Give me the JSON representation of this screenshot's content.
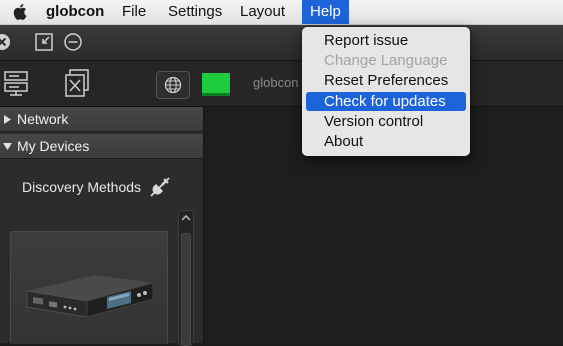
{
  "menubar": {
    "apple_icon": "apple-logo-icon",
    "items": [
      {
        "label": "globcon"
      },
      {
        "label": "File"
      },
      {
        "label": "Settings"
      },
      {
        "label": "Layout"
      },
      {
        "label": "Help"
      }
    ]
  },
  "help_menu": {
    "items": [
      {
        "label": "Report issue",
        "enabled": true
      },
      {
        "label": "Change Language",
        "enabled": false
      },
      {
        "label": "Reset Preferences",
        "enabled": true
      },
      {
        "label": "Check for updates",
        "enabled": true,
        "highlighted": true
      },
      {
        "label": "Version control",
        "enabled": true
      },
      {
        "label": "About",
        "enabled": true
      }
    ]
  },
  "titlebar": {
    "icons": [
      "close-icon",
      "restore-window-icon",
      "minimize-icon"
    ]
  },
  "toolbar": {
    "icons": [
      "device-list-icon",
      "close-document-icon",
      "globe-icon"
    ],
    "status_color": "#1ecc3c",
    "device_name": "globcon"
  },
  "sidebar": {
    "sections": [
      {
        "label": "Network",
        "expanded": false
      },
      {
        "label": "My Devices",
        "expanded": true
      }
    ],
    "discovery_label": "Discovery Methods",
    "discovery_icon": "plug-disabled-icon",
    "device_card_icon": "hardware-device-icon"
  },
  "colors": {
    "accent": "#1d64da",
    "status_online": "#1ecc3c"
  }
}
